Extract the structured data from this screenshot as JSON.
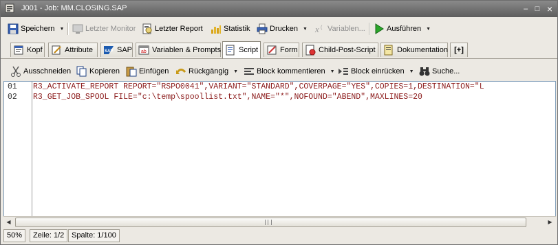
{
  "window": {
    "title": "J001 - Job: MM.CLOSING.SAP",
    "controls": {
      "minimize": "–",
      "maximize": "□",
      "close": "×"
    }
  },
  "toolbar": {
    "save": "Speichern",
    "last_monitor": "Letzter Monitor",
    "last_report": "Letzter Report",
    "statistics": "Statistik",
    "print": "Drucken",
    "variables": "Variablen...",
    "execute": "Ausführen"
  },
  "tabs": [
    {
      "label": "Kopf",
      "icon": "header-icon"
    },
    {
      "label": "Attribute",
      "icon": "attributes-icon"
    },
    {
      "label": "SAP",
      "icon": "sap-icon"
    },
    {
      "label": "Variablen & Prompts",
      "icon": "variables-icon"
    },
    {
      "label": "Script",
      "icon": "script-icon",
      "active": true
    },
    {
      "label": "Form",
      "icon": "form-icon"
    },
    {
      "label": "Child-Post-Script",
      "icon": "child-post-script-icon"
    },
    {
      "label": "Dokumentation",
      "icon": "documentation-icon"
    },
    {
      "label": "[+]",
      "icon": "add-tab-icon"
    }
  ],
  "editor_toolbar": {
    "cut": "Ausschneiden",
    "copy": "Kopieren",
    "paste": "Einfügen",
    "undo": "Rückgängig",
    "comment_block": "Block kommentieren",
    "indent_block": "Block einrücken",
    "search": "Suche..."
  },
  "editor": {
    "lines": [
      {
        "num": "01",
        "text": "R3_ACTIVATE_REPORT REPORT=\"RSPO0041\",VARIANT=\"STANDARD\",COVERPAGE=\"YES\",COPIES=1,DESTINATION=\"L"
      },
      {
        "num": "02",
        "text": "R3_GET_JOB_SPOOL FILE=\"c:\\temp\\spoollist.txt\",NAME=\"*\",NOFOUND=\"ABEND\",MAXLINES=20"
      }
    ]
  },
  "statusbar": {
    "zoom": "50%",
    "line": "Zeile: 1/2",
    "column": "Spalte: 1/100"
  },
  "colors": {
    "code_text": "#8b1a1a",
    "titlebar": "#6f6f6f",
    "editor_border": "#7f9db9"
  }
}
